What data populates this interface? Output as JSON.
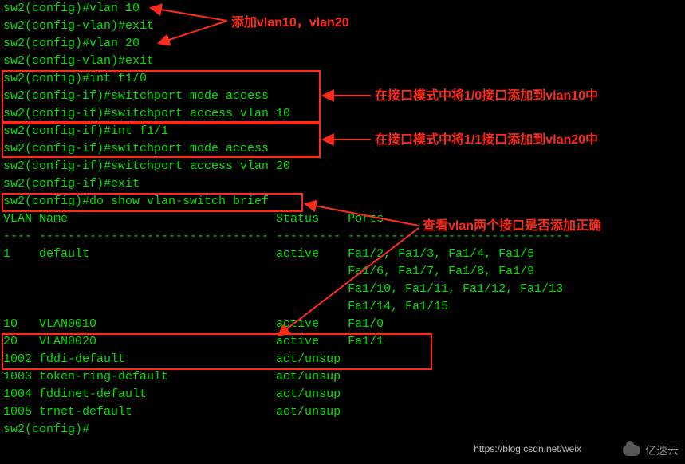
{
  "lines": {
    "l0": "sw2(config)#vlan 10",
    "l1": "sw2(config-vlan)#exit",
    "l2": "sw2(config)#vlan 20",
    "l3": "sw2(config-vlan)#exit",
    "l4": "sw2(config)#int f1/0",
    "l5": "sw2(config-if)#switchport mode access",
    "l6": "sw2(config-if)#switchport access vlan 10",
    "l7": "sw2(config-if)#int f1/1",
    "l8": "sw2(config-if)#switchport mode access",
    "l9": "sw2(config-if)#switchport access vlan 20",
    "l10": "sw2(config-if)#exit",
    "l11": "sw2(config)#do show vlan-switch brief",
    "blank": "",
    "hdr": "VLAN Name                             Status    Ports",
    "dash": "---- -------------------------------- --------- -------------------------------",
    "v1a": "1    default                          active    Fa1/2, Fa1/3, Fa1/4, Fa1/5",
    "v1b": "                                                Fa1/6, Fa1/7, Fa1/8, Fa1/9",
    "v1c": "                                                Fa1/10, Fa1/11, Fa1/12, Fa1/13",
    "v1d": "                                                Fa1/14, Fa1/15",
    "v10": "10   VLAN0010                         active    Fa1/0",
    "v20": "20   VLAN0020                         active    Fa1/1",
    "v1002": "1002 fddi-default                     act/unsup",
    "v1003": "1003 token-ring-default               act/unsup",
    "v1004": "1004 fddinet-default                  act/unsup",
    "v1005": "1005 trnet-default                    act/unsup",
    "prompt": "sw2(config)#"
  },
  "ann": {
    "a1": "添加vlan10，vlan20",
    "a2": "在接口模式中将1/0接口添加到vlan10中",
    "a3": "在接口模式中将1/1接口添加到vlan20中",
    "a4": "查看vlan两个接口是否添加正确"
  },
  "watermark": "亿速云",
  "url": "https://blog.csdn.net/weix"
}
